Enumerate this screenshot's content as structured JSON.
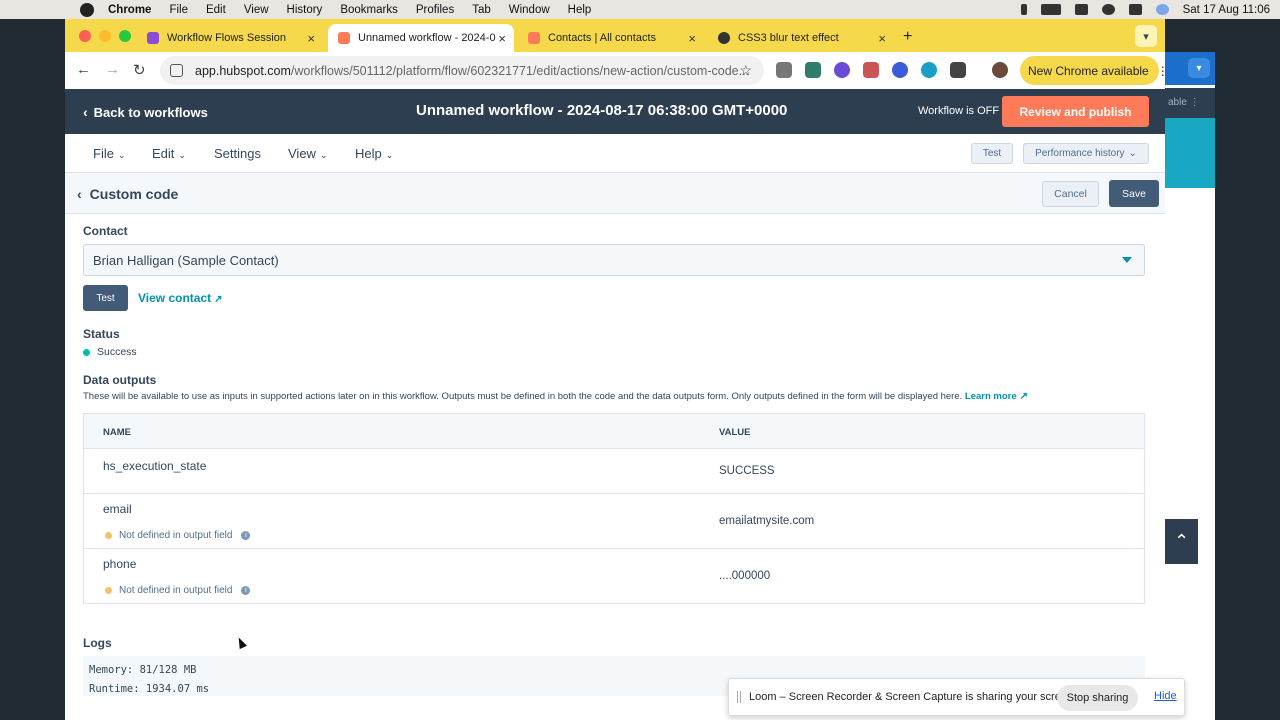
{
  "menubar": {
    "app": "Chrome",
    "items": [
      "File",
      "Edit",
      "View",
      "History",
      "Bookmarks",
      "Profiles",
      "Tab",
      "Window",
      "Help"
    ],
    "clock": "Sat 17 Aug  11:06"
  },
  "tabs": [
    {
      "label": "Workflow Flows Session",
      "close": "×"
    },
    {
      "label": "Unnamed workflow - 2024-0",
      "close": "×"
    },
    {
      "label": "Contacts | All contacts",
      "close": "×"
    },
    {
      "label": "CSS3 blur text effect",
      "close": "×"
    }
  ],
  "tab_new": "+",
  "browser": {
    "url_host": "app.hubspot.com",
    "url_path": "/workflows/501112/platform/flow/602321771/edit/actions/new-action/custom-code...",
    "new_chrome": "New Chrome available"
  },
  "header": {
    "back": "Back to workflows",
    "title": "Unnamed workflow - 2024-08-17 06:38:00 GMT+0000",
    "status": "Workflow is OFF",
    "review_button": "Review and publish"
  },
  "menu": {
    "file": "File",
    "edit": "Edit",
    "settings": "Settings",
    "view": "View",
    "help": "Help",
    "test": "Test",
    "performance": "Performance history"
  },
  "panel": {
    "title": "Custom code",
    "cancel": "Cancel",
    "save": "Save"
  },
  "contact": {
    "label": "Contact",
    "selected": "Brian Halligan (Sample Contact)",
    "test_button": "Test",
    "view_contact": "View contact"
  },
  "status": {
    "label": "Status",
    "value": "Success",
    "color": "#00bda5"
  },
  "outputs": {
    "label": "Data outputs",
    "description": "These will be available to use as inputs in supported actions later on in this workflow. Outputs must be defined in both the code and the data outputs form. Only outputs defined in the form will be displayed here.",
    "learn_more": "Learn more",
    "col_name": "NAME",
    "col_value": "VALUE",
    "warning_text": "Not defined in output field",
    "warning_color": "#f5c26b",
    "rows": [
      {
        "name": "hs_execution_state",
        "value": "SUCCESS"
      },
      {
        "name": "email",
        "value": "emailatmysite.com"
      },
      {
        "name": "phone",
        "value": "....000000"
      }
    ]
  },
  "logs": {
    "label": "Logs",
    "memory": "Memory: 81/128 MB",
    "runtime": "Runtime: 1934.07 ms"
  },
  "background_window": {
    "fragment": "able"
  },
  "loom": {
    "message": "Loom – Screen Recorder & Screen Capture is sharing your screen.",
    "stop": "Stop sharing",
    "hide": "Hide"
  }
}
